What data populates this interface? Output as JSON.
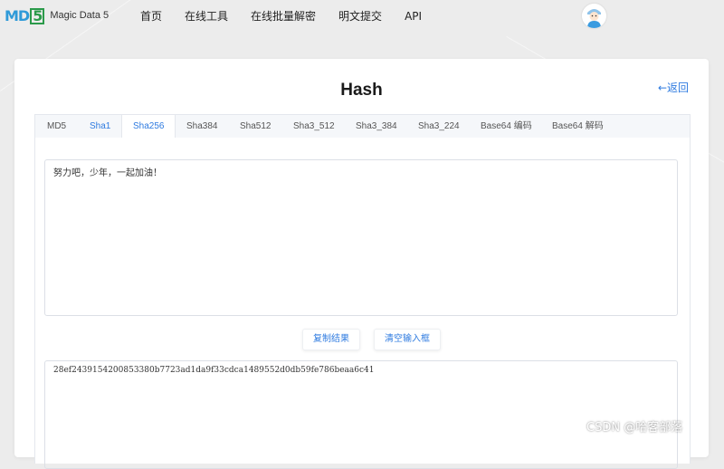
{
  "header": {
    "logo_mark": "MD",
    "logo_mark_five": "5",
    "logo_text": "Magic Data 5",
    "nav": [
      "首页",
      "在线工具",
      "在线批量解密",
      "明文提交",
      "API"
    ]
  },
  "card": {
    "title": "Hash",
    "back_label": "←返回"
  },
  "tabs": [
    "MD5",
    "Sha1",
    "Sha256",
    "Sha384",
    "Sha512",
    "Sha3_512",
    "Sha3_384",
    "Sha3_224",
    "Base64 编码",
    "Base64 解码"
  ],
  "active_tab": "Sha256",
  "input": {
    "value": "努力吧，少年，一起加油！"
  },
  "buttons": {
    "copy_label": "复制结果",
    "clear_label": "清空输入框"
  },
  "output": {
    "value": "28ef2439154200853380b7723ad1da9f33cdca1489552d0db59fe786beaa6c41"
  },
  "watermark": "CSDN @哈客部落",
  "colors": {
    "accent": "#2f7be0",
    "background": "#ececec",
    "logo_blue": "#2f9ad8",
    "logo_green": "#2b9a4a"
  }
}
